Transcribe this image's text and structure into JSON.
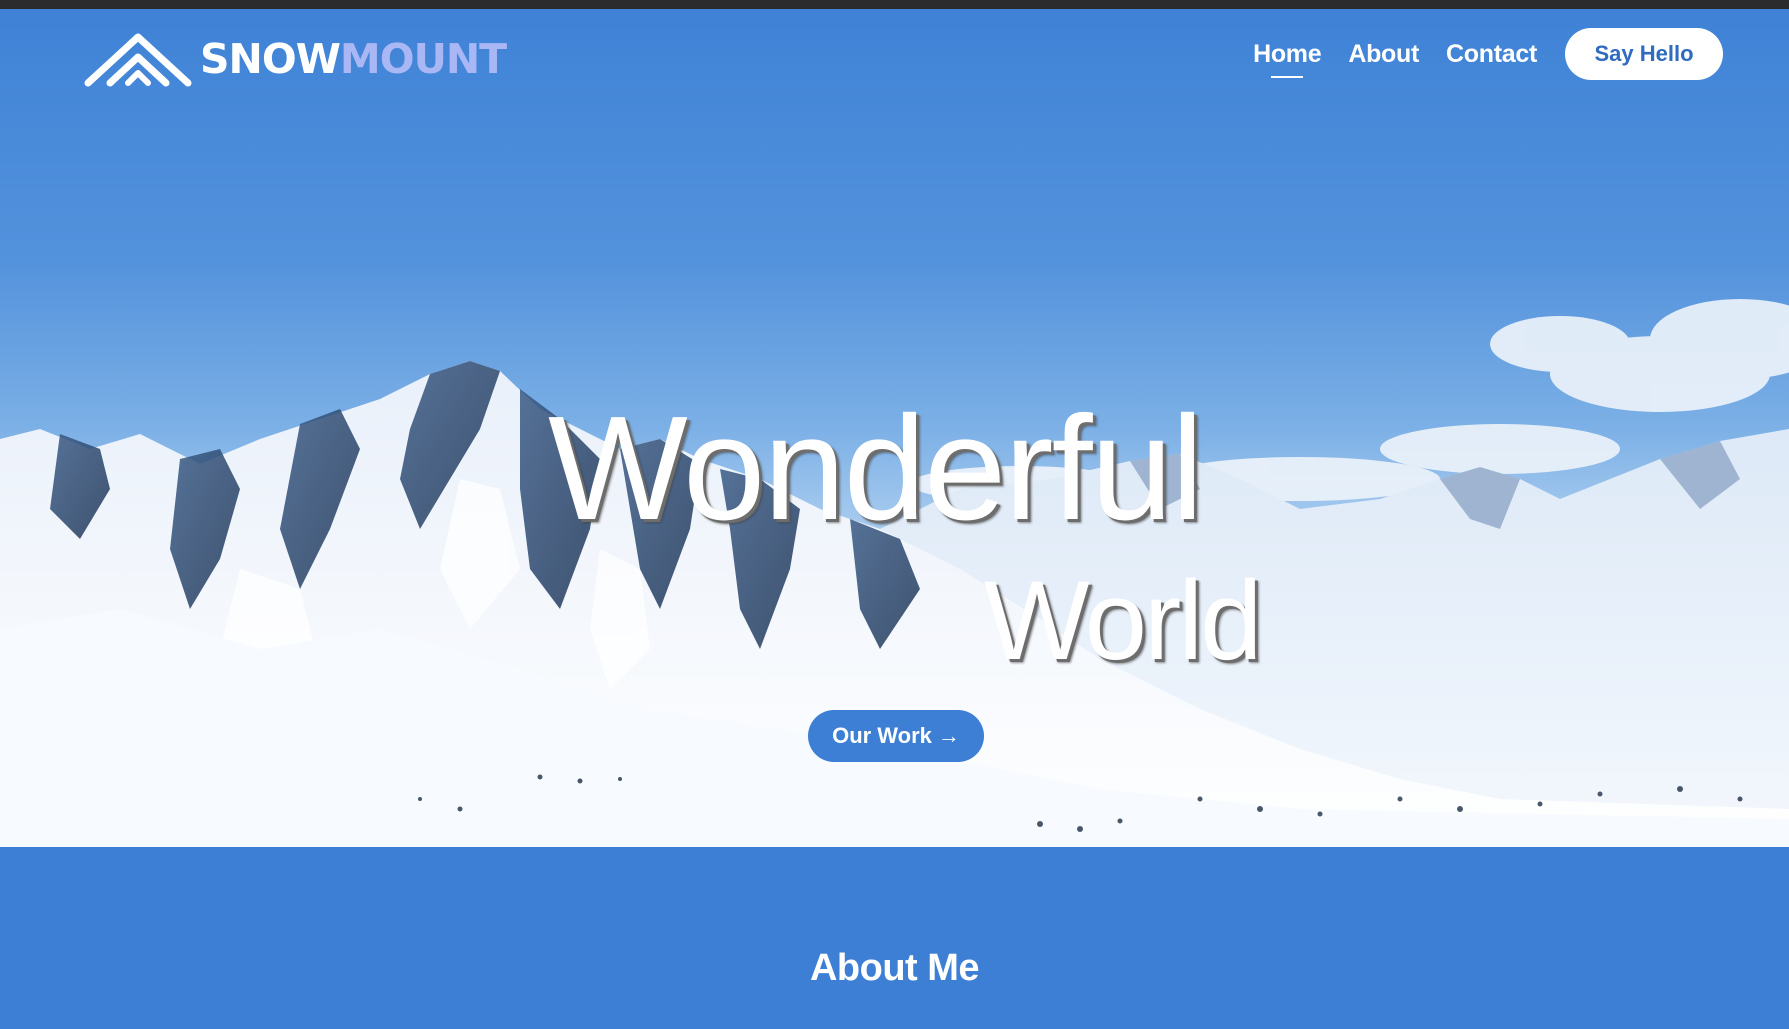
{
  "brand": {
    "name_part1": "SNOW",
    "name_part2": "MOUNT"
  },
  "nav": {
    "links": [
      {
        "label": "Home",
        "active": true
      },
      {
        "label": "About",
        "active": false
      },
      {
        "label": "Contact",
        "active": false
      }
    ],
    "cta_label": "Say Hello"
  },
  "hero": {
    "headline_line1": "Wonderful",
    "headline_line2": "World",
    "button_label": "Our Work",
    "button_arrow": "→"
  },
  "about": {
    "title": "About Me"
  },
  "colors": {
    "primary_blue": "#3d7fd4",
    "logo_accent": "#a9b7f4",
    "top_bar": "#2b2b2d",
    "cta_text": "#2f6bbf"
  }
}
